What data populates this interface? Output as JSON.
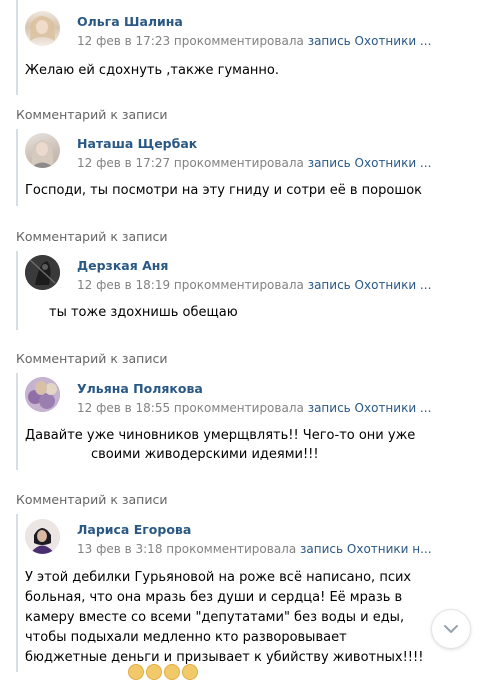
{
  "section_label": "Комментарий к записи",
  "comments": [
    {
      "author": "Ольга Шалина",
      "date": "12 фев в 17:23",
      "action": "прокомментировала",
      "link": "запись Охотники ...",
      "text": "Желаю ей сдохнуть ,также гуманно.",
      "avatar_icon": "user-photo-icon"
    },
    {
      "author": "Наташа Щербак",
      "date": "12 фев в 17:27",
      "action": "прокомментировала",
      "link": "запись Охотники ...",
      "text": "Господи, ты посмотри на эту гниду и сотри её в порошок",
      "avatar_icon": "user-photo-icon"
    },
    {
      "author": "Дерзкая Аня",
      "date": "12 фев в 18:19",
      "action": "прокомментировала",
      "link": "запись Охотники ...",
      "text": "ты тоже здохнишь обещаю",
      "avatar_icon": "user-photo-icon"
    },
    {
      "author": "Ульяна Полякова",
      "date": "12 фев в 18:55",
      "action": "прокомментировала",
      "link": "запись Охотники ...",
      "text_line1": "Давайте уже чиновников умерщвлять!! Чего-то они уже",
      "text_line2": "своими живодерскими идеями!!!",
      "avatar_icon": "user-photo-icon"
    },
    {
      "author": "Лариса Егорова",
      "date": "13 фев в 3:18",
      "action": "прокомментировала",
      "link": "запись Охотники н...",
      "text_lines": [
        "У этой дебилки Гурьяновой на роже всё написано, псих",
        "больная, что она мразь без души и сердца! Её мразь в",
        "камеру вместе со всеми \"депутатами\" без воды и еды,",
        "чтобы подыхали медленно кто разворовывает",
        "бюджетные деньги и призывает к убийству животных!!!!"
      ],
      "avatar_icon": "user-photo-icon"
    }
  ],
  "scroll_button_icon": "chevron-down-icon"
}
